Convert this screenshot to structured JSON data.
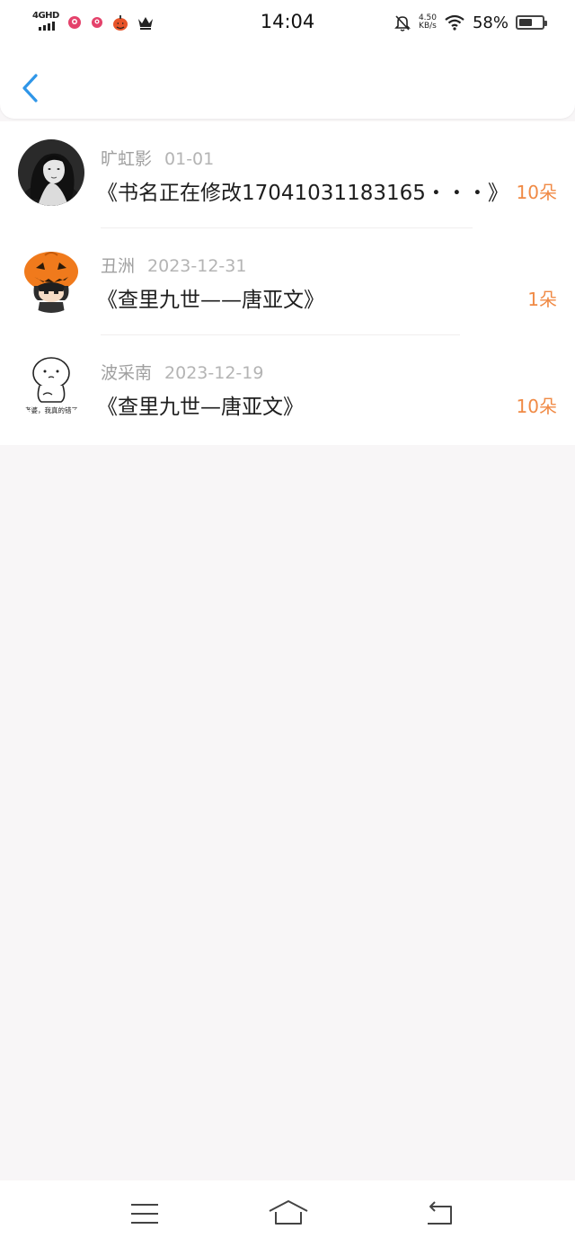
{
  "status_bar": {
    "network": "4GHD",
    "time": "14:04",
    "speed_value": "4.50",
    "speed_unit": "KB/s",
    "battery": "58%",
    "notification_icons": [
      "chat-bubble-icon",
      "chat-bubble-icon",
      "pumpkin-icon",
      "crown-icon"
    ]
  },
  "header": {
    "back_icon": "chevron-left-icon",
    "accent": "#2f96e8"
  },
  "items": [
    {
      "user": "旷虹影",
      "date": "01-01",
      "title": "《书名正在修改17041031183165・・・》",
      "count": "10朵"
    },
    {
      "user": "丑洲",
      "date": "2023-12-31",
      "title": "《查里九世——唐亚文》",
      "count": "1朵"
    },
    {
      "user": "波采南",
      "date": "2023-12-19",
      "title": "《查里九世—唐亚文》",
      "count": "10朵"
    }
  ],
  "avatar_caption": "老婆，我真的错了",
  "colors": {
    "count": "#f08a45",
    "meta": "#a0a0a0",
    "background": "#f8f6f7"
  },
  "nav_bar": {
    "icons": [
      "menu-icon",
      "home-icon",
      "back-arrow-icon"
    ]
  }
}
